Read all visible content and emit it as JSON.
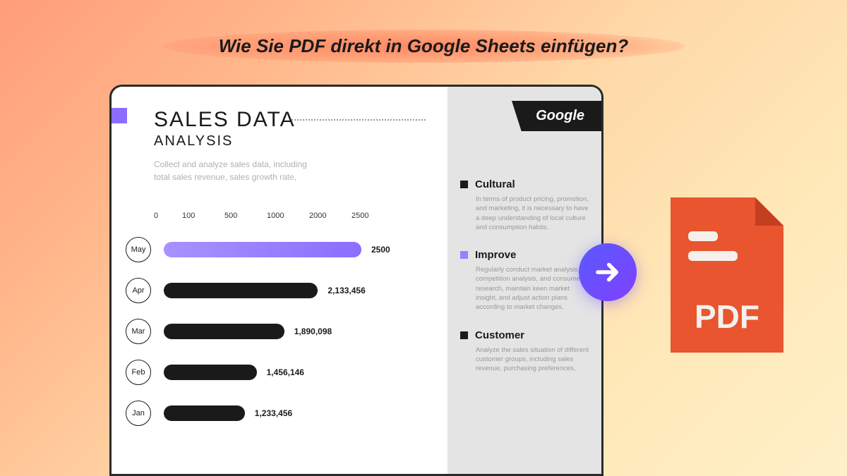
{
  "title": "Wie Sie PDF direkt in Google Sheets einfügen?",
  "panel": {
    "heading1": "SALES DATA",
    "heading2": "ANALYSIS",
    "subtext": "Collect and analyze sales data, including total sales revenue, sales growth rate,",
    "google_label": "Google",
    "axis": [
      "0",
      "100",
      "500",
      "1000",
      "2000",
      "2500"
    ],
    "sidebar": [
      {
        "title": "Cultural",
        "desc": "In terms of product pricing, promotion, and marketing, it is necessary to have a deep understanding of local culture and consumption habits.",
        "color": "black"
      },
      {
        "title": "Improve",
        "desc": "Regularly conduct market analysis, competition analysis, and consumer research, maintain keen market insight, and adjust action plans according to market changes.",
        "color": "purple"
      },
      {
        "title": "Customer",
        "desc": "Analyze the sales situation of different customer groups, including sales revenue, purchasing preferences,",
        "color": "black"
      }
    ]
  },
  "pdf_label": "PDF",
  "chart_data": {
    "type": "bar",
    "orientation": "horizontal",
    "categories": [
      "May",
      "Apr",
      "Mar",
      "Feb",
      "Jan"
    ],
    "values": [
      2500,
      2133456,
      1890098,
      1456146,
      1233456
    ],
    "display_values": [
      "2500",
      "2,133,456",
      "1,890,098",
      "1,456,146",
      "1,233,456"
    ],
    "bar_widths_pct": [
      100,
      78,
      61,
      47,
      41
    ],
    "highlight_index": 0,
    "title": "SALES DATA ANALYSIS",
    "xlabel": "",
    "ylabel": "",
    "axis_ticks": [
      0,
      100,
      500,
      1000,
      2000,
      2500
    ]
  }
}
